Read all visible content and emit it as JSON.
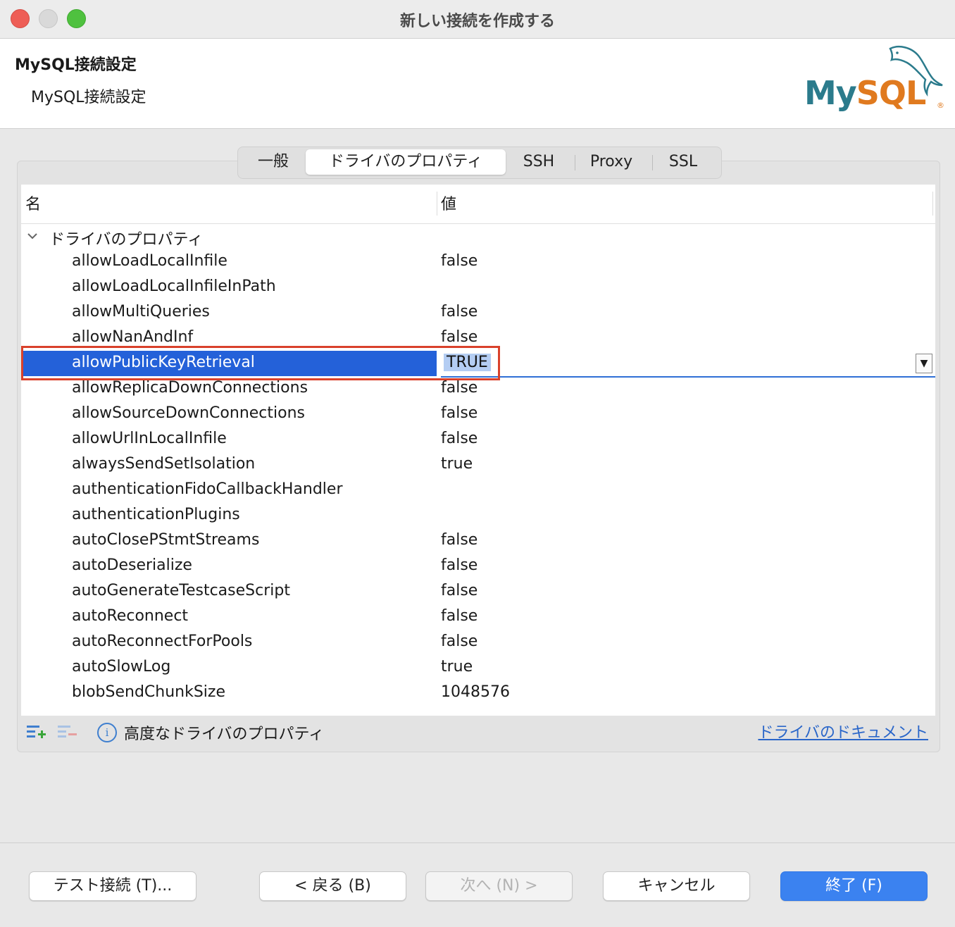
{
  "window": {
    "title": "新しい接続を作成する"
  },
  "header": {
    "title": "MySQL接続設定",
    "subtitle": "MySQL接続設定",
    "logo_my": "My",
    "logo_sql": "SQL",
    "logo_reg": "®"
  },
  "tabs": [
    {
      "label": "一般"
    },
    {
      "label": "ドライバのプロパティ",
      "active": true
    },
    {
      "label": "SSH"
    },
    {
      "label": "Proxy"
    },
    {
      "label": "SSL"
    }
  ],
  "table": {
    "col_name": "名",
    "col_value": "値",
    "group_label": "ドライバのプロパティ",
    "rows": [
      {
        "name": "allowLoadLocalInfile",
        "value": "false"
      },
      {
        "name": "allowLoadLocalInfileInPath",
        "value": ""
      },
      {
        "name": "allowMultiQueries",
        "value": "false"
      },
      {
        "name": "allowNanAndInf",
        "value": "false"
      },
      {
        "name": "allowPublicKeyRetrieval",
        "value": "TRUE",
        "selected": true
      },
      {
        "name": "allowReplicaDownConnections",
        "value": "false"
      },
      {
        "name": "allowSourceDownConnections",
        "value": "false"
      },
      {
        "name": "allowUrlInLocalInfile",
        "value": "false"
      },
      {
        "name": "alwaysSendSetIsolation",
        "value": "true"
      },
      {
        "name": "authenticationFidoCallbackHandler",
        "value": ""
      },
      {
        "name": "authenticationPlugins",
        "value": ""
      },
      {
        "name": "autoClosePStmtStreams",
        "value": "false"
      },
      {
        "name": "autoDeserialize",
        "value": "false"
      },
      {
        "name": "autoGenerateTestcaseScript",
        "value": "false"
      },
      {
        "name": "autoReconnect",
        "value": "false"
      },
      {
        "name": "autoReconnectForPools",
        "value": "false"
      },
      {
        "name": "autoSlowLog",
        "value": "true"
      },
      {
        "name": "blobSendChunkSize",
        "value": "1048576"
      }
    ],
    "dropdown_glyph": "▼"
  },
  "bottom": {
    "info_glyph": "i",
    "advanced_label": "高度なドライバのプロパティ",
    "doc_link": "ドライバのドキュメント"
  },
  "buttons": {
    "test": "テスト接続 (T)...",
    "back": "< 戻る (B)",
    "next": "次へ (N) >",
    "cancel": "キャンセル",
    "finish": "終了 (F)"
  },
  "colors": {
    "selection": "#2461d9",
    "highlight_border": "#d9412b",
    "primary_button": "#3b82f0",
    "link": "#2a66c9"
  }
}
